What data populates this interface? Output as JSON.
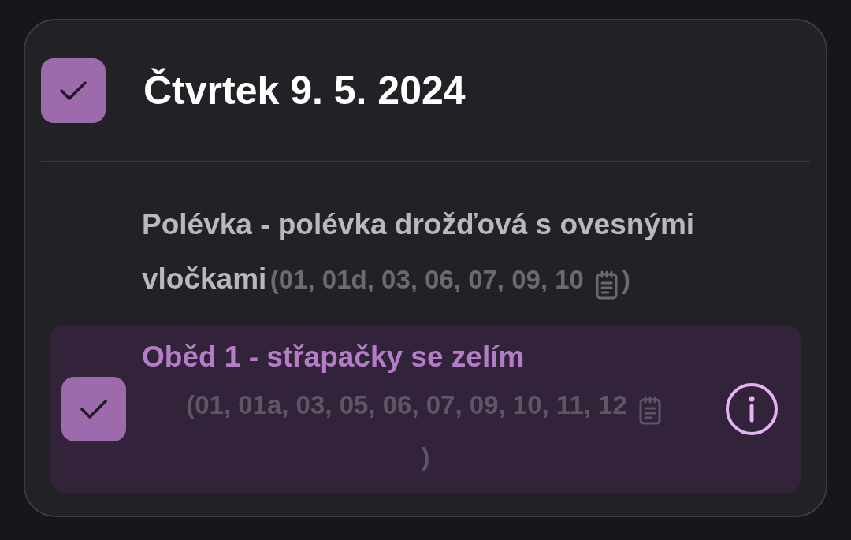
{
  "day": {
    "title": "Čtvrtek 9. 5. 2024",
    "checked": true
  },
  "items": [
    {
      "name": "Polévka - polévka drožďová s ovesnými vločkami",
      "allergens": "(01, 01d, 03, 06, 07, 09, 10",
      "closing": ")",
      "checked": false
    },
    {
      "name": "Oběd 1 - střapačky se zelím",
      "allergens": "(01, 01a, 03, 05, 06, 07, 09, 10, 11, 12",
      "closing": ")",
      "checked": true
    }
  ]
}
